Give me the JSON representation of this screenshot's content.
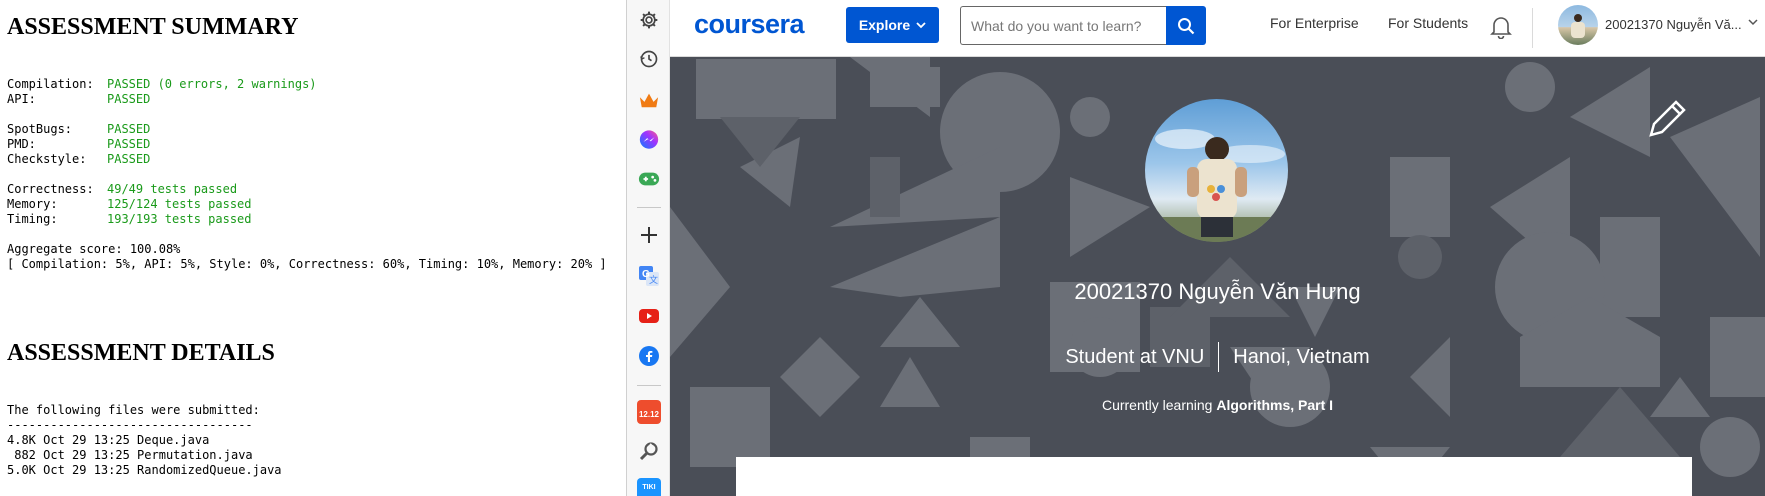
{
  "report": {
    "summary_heading": "ASSESSMENT SUMMARY",
    "summary_lines": [
      {
        "label": "Compilation:",
        "value": "PASSED (0 errors, 2 warnings)"
      },
      {
        "label": "API:",
        "value": "PASSED"
      },
      {
        "label": "SpotBugs:",
        "value": "PASSED"
      },
      {
        "label": "PMD:",
        "value": "PASSED"
      },
      {
        "label": "Checkstyle:",
        "value": "PASSED"
      },
      {
        "label": "Correctness:",
        "value": "49/49 tests passed"
      },
      {
        "label": "Memory:",
        "value": "125/124 tests passed"
      },
      {
        "label": "Timing:",
        "value": "193/193 tests passed"
      }
    ],
    "aggregate": "Aggregate score: 100.08%",
    "weights": "[ Compilation: 5%, API: 5%, Style: 0%, Correctness: 60%, Timing: 10%, Memory: 20% ]",
    "details_heading": "ASSESSMENT DETAILS",
    "files_intro": "The following files were submitted:",
    "files_rule": "----------------------------------",
    "files": [
      "4.8K Oct 29 13:25 Deque.java",
      " 882 Oct 29 13:25 Permutation.java",
      "5.0K Oct 29 13:25 RandomizedQueue.java"
    ]
  },
  "sidebar": {
    "icons": [
      "gear-icon",
      "history-icon",
      "crown-icon",
      "messenger-icon",
      "gamepad-icon",
      "add-icon",
      "translate-icon",
      "youtube-icon",
      "facebook-icon",
      "shopee-icon",
      "wrench-icon",
      "tiki-icon"
    ],
    "shopee_badge": "12.12",
    "tiki_badge": "TIKI"
  },
  "coursera": {
    "logo": "coursera",
    "explore_label": "Explore",
    "search_placeholder": "What do you want to learn?",
    "for_enterprise": "For Enterprise",
    "for_students": "For Students",
    "username_nav": "20021370 Nguyễn Vă...",
    "profile_name": "20021370 Nguyễn Văn Hưng",
    "profile_role": "Student at VNU",
    "profile_location": "Hanoi, Vietnam",
    "learning_prefix": "Currently learning ",
    "learning_course": "Algorithms, Part I"
  },
  "colors": {
    "brand_blue": "#0056d2",
    "banner_bg": "#4a4e57",
    "passed_green": "#1a9a1a"
  }
}
